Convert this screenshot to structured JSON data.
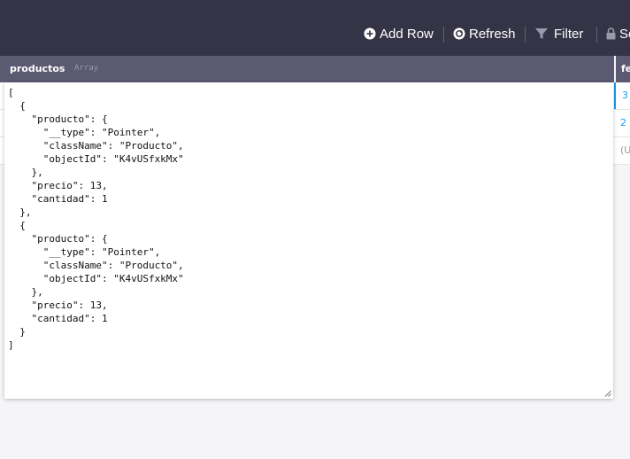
{
  "toolbar": {
    "add_row_label": "Add Row",
    "refresh_label": "Refresh",
    "filter_label": "Filter",
    "security_label": "Se",
    "icons": [
      "plus-circle-icon",
      "refresh-icon",
      "filter-icon",
      "lock-icon"
    ]
  },
  "column": {
    "name": "productos",
    "type": "Array"
  },
  "next_column": {
    "name": "fe"
  },
  "rows_right": [
    "3",
    "2",
    "(U"
  ],
  "editor": {
    "value": "[\n  {\n    \"producto\": {\n      \"__type\": \"Pointer\",\n      \"className\": \"Producto\",\n      \"objectId\": \"K4vUSfxkMx\"\n    },\n    \"precio\": 13,\n    \"cantidad\": 1\n  },\n  {\n    \"producto\": {\n      \"__type\": \"Pointer\",\n      \"className\": \"Producto\",\n      \"objectId\": \"K4vUSfxkMx\"\n    },\n    \"precio\": 13,\n    \"cantidad\": 1\n  }\n]"
  },
  "colors": {
    "toolbar_bg": "#353446",
    "header_bg": "#5b5a72",
    "link_blue": "#169cee"
  }
}
